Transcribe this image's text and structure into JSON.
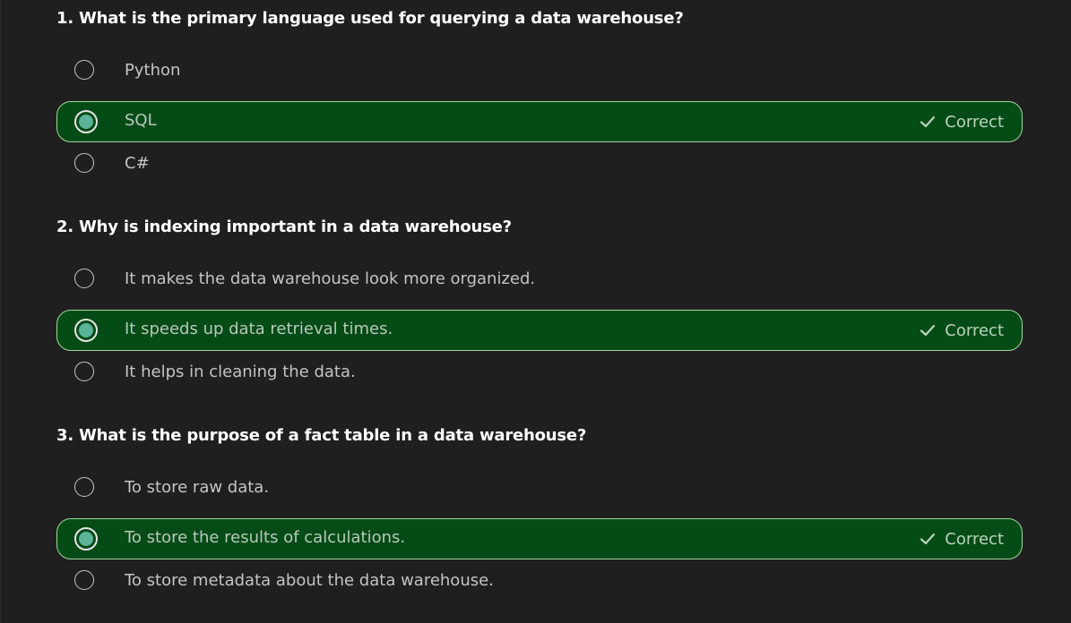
{
  "questions": [
    {
      "title": "1. What is the primary language used for querying a data warehouse?",
      "options": [
        "Python",
        "SQL",
        "C#"
      ],
      "selected": 1,
      "feedback": "Correct"
    },
    {
      "title": "2. Why is indexing important in a data warehouse?",
      "options": [
        "It makes the data warehouse look more organized.",
        "It speeds up data retrieval times.",
        "It helps in cleaning the data."
      ],
      "selected": 1,
      "feedback": "Correct"
    },
    {
      "title": "3. What is the purpose of a fact table in a data warehouse?",
      "options": [
        "To store raw data.",
        "To store the results of calculations.",
        "To store metadata about the data warehouse."
      ],
      "selected": 1,
      "feedback": "Correct"
    }
  ],
  "colors": {
    "background": "#1f1f1f",
    "correct_bg": "#054b16",
    "correct_border": "#9fd89f",
    "radio_fill": "#5bb39a"
  },
  "icons": {
    "feedback": "checkmark-icon",
    "option": "radio-button"
  }
}
